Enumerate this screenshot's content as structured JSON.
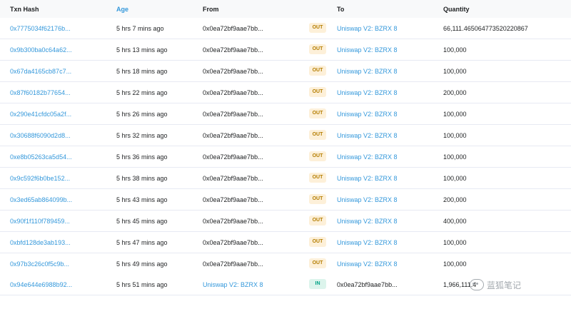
{
  "header": {
    "txn_hash": "Txn Hash",
    "age": "Age",
    "from": "From",
    "to": "To",
    "quantity": "Quantity"
  },
  "rows": [
    {
      "hash": "0x7775034f62176b...",
      "age": "5 hrs 7 mins ago",
      "from": "0x0ea72bf9aae7bb...",
      "dir": "OUT",
      "to": "Uniswap V2: BZRX 8",
      "qty": "66,111.465064773520220867"
    },
    {
      "hash": "0x9b300ba0c64a62...",
      "age": "5 hrs 13 mins ago",
      "from": "0x0ea72bf9aae7bb...",
      "dir": "OUT",
      "to": "Uniswap V2: BZRX 8",
      "qty": "100,000"
    },
    {
      "hash": "0x67da4165cb87c7...",
      "age": "5 hrs 18 mins ago",
      "from": "0x0ea72bf9aae7bb...",
      "dir": "OUT",
      "to": "Uniswap V2: BZRX 8",
      "qty": "100,000"
    },
    {
      "hash": "0x87f60182b77654...",
      "age": "5 hrs 22 mins ago",
      "from": "0x0ea72bf9aae7bb...",
      "dir": "OUT",
      "to": "Uniswap V2: BZRX 8",
      "qty": "200,000"
    },
    {
      "hash": "0x290e41cfdc05a2f...",
      "age": "5 hrs 26 mins ago",
      "from": "0x0ea72bf9aae7bb...",
      "dir": "OUT",
      "to": "Uniswap V2: BZRX 8",
      "qty": "100,000"
    },
    {
      "hash": "0x30688f6090d2d8...",
      "age": "5 hrs 32 mins ago",
      "from": "0x0ea72bf9aae7bb...",
      "dir": "OUT",
      "to": "Uniswap V2: BZRX 8",
      "qty": "100,000"
    },
    {
      "hash": "0xe8b05263ca5d54...",
      "age": "5 hrs 36 mins ago",
      "from": "0x0ea72bf9aae7bb...",
      "dir": "OUT",
      "to": "Uniswap V2: BZRX 8",
      "qty": "100,000"
    },
    {
      "hash": "0x9c592f6b0be152...",
      "age": "5 hrs 38 mins ago",
      "from": "0x0ea72bf9aae7bb...",
      "dir": "OUT",
      "to": "Uniswap V2: BZRX 8",
      "qty": "100,000"
    },
    {
      "hash": "0x3ed65ab864099b...",
      "age": "5 hrs 43 mins ago",
      "from": "0x0ea72bf9aae7bb...",
      "dir": "OUT",
      "to": "Uniswap V2: BZRX 8",
      "qty": "200,000"
    },
    {
      "hash": "0x90f1f110f789459...",
      "age": "5 hrs 45 mins ago",
      "from": "0x0ea72bf9aae7bb...",
      "dir": "OUT",
      "to": "Uniswap V2: BZRX 8",
      "qty": "400,000"
    },
    {
      "hash": "0xbfd128de3ab193...",
      "age": "5 hrs 47 mins ago",
      "from": "0x0ea72bf9aae7bb...",
      "dir": "OUT",
      "to": "Uniswap V2: BZRX 8",
      "qty": "100,000"
    },
    {
      "hash": "0x97b3c26c0f5c9b...",
      "age": "5 hrs 49 mins ago",
      "from": "0x0ea72bf9aae7bb...",
      "dir": "OUT",
      "to": "Uniswap V2: BZRX 8",
      "qty": "100,000"
    },
    {
      "hash": "0x94e644e6988b92...",
      "age": "5 hrs 51 mins ago",
      "from": "Uniswap V2: BZRX 8",
      "dir": "IN",
      "to": "0x0ea72bf9aae7bb...",
      "qty": "1,966,111.4"
    }
  ],
  "watermark": {
    "text": "蓝狐笔记",
    "icon": "wechat-icon"
  },
  "colors": {
    "link": "#3498db",
    "out_bg": "#fdf0d9",
    "out_fg": "#b47d00",
    "in_bg": "#dcf4ec",
    "in_fg": "#00a186"
  }
}
